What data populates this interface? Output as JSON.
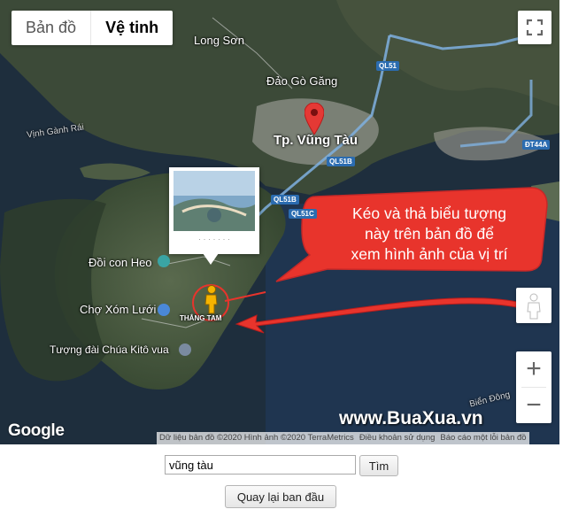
{
  "map_type": {
    "map_label": "Bản đồ",
    "satellite_label": "Vệ tinh"
  },
  "places": {
    "long_son": "Long Sơn",
    "dao_go_gang": "Đảo Gò Găng",
    "vinh_ganh_rai": "Vịnh Gành Rái",
    "tp_vung_tau": "Tp. Vũng Tàu",
    "doi_con_heo": "Đồi con Heo",
    "cho_xom_luoi": "Chợ Xóm Lưới",
    "tuong_dai": "Tượng đài Chúa Kitô vua",
    "thang_tam": "THẮNG TAM",
    "bien_dong": "Biển Đông"
  },
  "roads": {
    "ql51": "QL51",
    "ql51b_a": "QL51B",
    "ql51b_b": "QL51B",
    "ql51c": "QL51C",
    "dt44a": "ĐT44A"
  },
  "callout": {
    "line1": "Kéo và thả biểu tượng",
    "line2": "này trên bản đồ để",
    "line3": "xem hình ảnh của vị trí"
  },
  "watermark": "www.BuaXua.vn",
  "google_logo": "Google",
  "attribution": {
    "data": "Dữ liệu bản đồ ©2020 Hình ảnh ©2020 TerraMetrics",
    "terms": "Điều khoản sử dụng",
    "report": "Báo cáo một lỗi bản đồ"
  },
  "search": {
    "value": "vũng tàu",
    "button": "Tìm"
  },
  "reset_button": "Quay lại ban đầu",
  "colors": {
    "callout": "#e8342c",
    "water": "#1c2c3c",
    "marker": "#e53935",
    "road": "#7fb0e0"
  },
  "icons": [
    "fullscreen-icon",
    "pegman-icon",
    "zoom-in-icon",
    "zoom-out-icon",
    "map-marker-icon",
    "camera-icon"
  ]
}
